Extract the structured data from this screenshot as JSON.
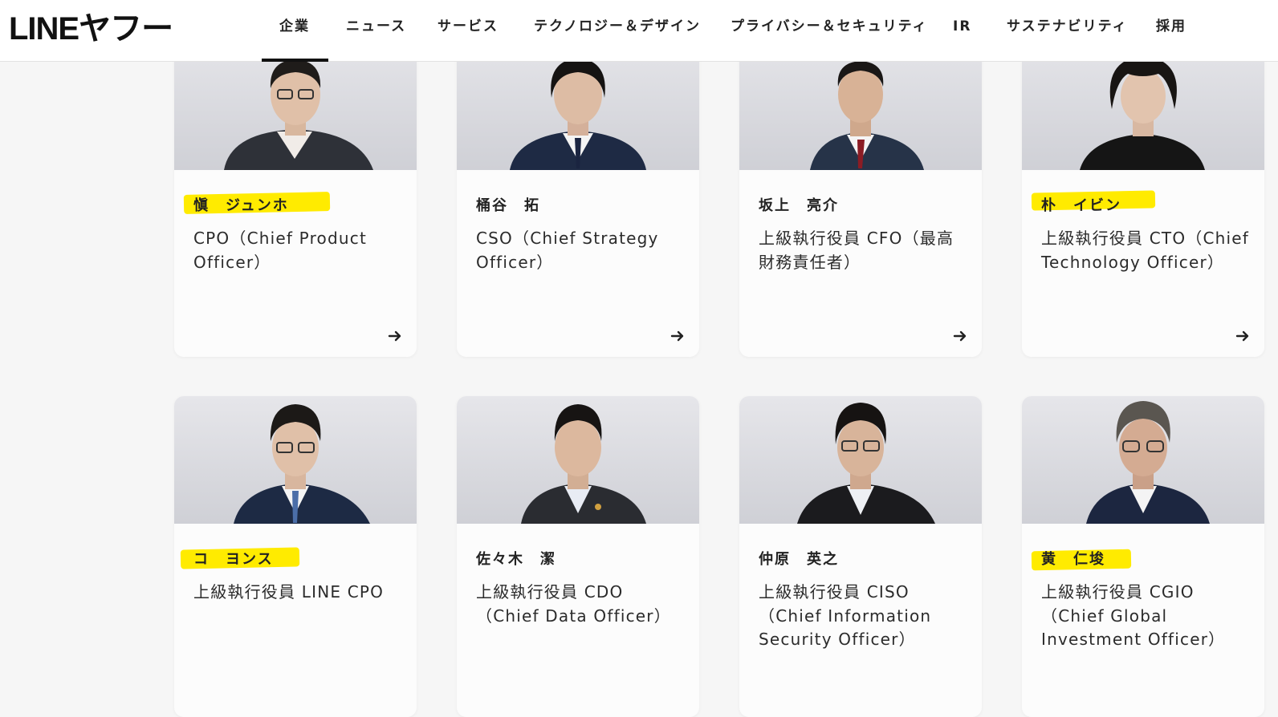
{
  "header": {
    "logo": "LINEヤフー",
    "nav": [
      {
        "label": "企業",
        "active": true
      },
      {
        "label": "ニュース"
      },
      {
        "label": "サービス"
      },
      {
        "label": "テクノロジー＆デザイン"
      },
      {
        "label": "プライバシー＆セキュリティ"
      },
      {
        "label": "IR"
      },
      {
        "label": "サステナビリティ"
      },
      {
        "label": "採用"
      }
    ]
  },
  "colors": {
    "highlight": "#ffeb00",
    "card_bg": "#fcfcfc",
    "page_bg": "#f6f6f6"
  },
  "executives": [
    {
      "name": "愼　ジュンホ",
      "title": "CPO（Chief Product Officer）",
      "highlighted": true
    },
    {
      "name": "桶谷　拓",
      "title": "CSO（Chief Strategy Officer）",
      "highlighted": false
    },
    {
      "name": "坂上　亮介",
      "title": "上級執行役員 CFO（最高財務責任者）",
      "highlighted": false
    },
    {
      "name": "朴　イビン",
      "title": "上級執行役員 CTO（Chief Technology Officer）",
      "highlighted": true
    },
    {
      "name": "コ　ヨンス",
      "title": "上級執行役員 LINE CPO",
      "highlighted": true
    },
    {
      "name": "佐々木　潔",
      "title": "上級執行役員 CDO（Chief Data Officer）",
      "highlighted": false
    },
    {
      "name": "仲原　英之",
      "title": "上級執行役員 CISO（Chief Information Security Officer）",
      "highlighted": false
    },
    {
      "name": "黄　仁埈",
      "title": "上級執行役員 CGIO（Chief Global Investment Officer）",
      "highlighted": true
    }
  ],
  "card_arrow_icon": "arrow-right-icon"
}
